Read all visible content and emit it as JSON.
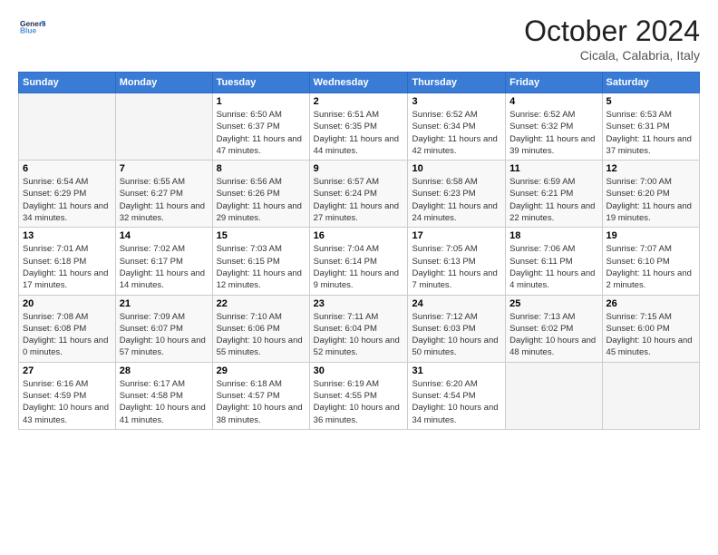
{
  "logo": {
    "line1": "General",
    "line2": "Blue"
  },
  "title": "October 2024",
  "location": "Cicala, Calabria, Italy",
  "days_header": [
    "Sunday",
    "Monday",
    "Tuesday",
    "Wednesday",
    "Thursday",
    "Friday",
    "Saturday"
  ],
  "weeks": [
    [
      {
        "day": "",
        "info": ""
      },
      {
        "day": "",
        "info": ""
      },
      {
        "day": "1",
        "info": "Sunrise: 6:50 AM\nSunset: 6:37 PM\nDaylight: 11 hours and 47 minutes."
      },
      {
        "day": "2",
        "info": "Sunrise: 6:51 AM\nSunset: 6:35 PM\nDaylight: 11 hours and 44 minutes."
      },
      {
        "day": "3",
        "info": "Sunrise: 6:52 AM\nSunset: 6:34 PM\nDaylight: 11 hours and 42 minutes."
      },
      {
        "day": "4",
        "info": "Sunrise: 6:52 AM\nSunset: 6:32 PM\nDaylight: 11 hours and 39 minutes."
      },
      {
        "day": "5",
        "info": "Sunrise: 6:53 AM\nSunset: 6:31 PM\nDaylight: 11 hours and 37 minutes."
      }
    ],
    [
      {
        "day": "6",
        "info": "Sunrise: 6:54 AM\nSunset: 6:29 PM\nDaylight: 11 hours and 34 minutes."
      },
      {
        "day": "7",
        "info": "Sunrise: 6:55 AM\nSunset: 6:27 PM\nDaylight: 11 hours and 32 minutes."
      },
      {
        "day": "8",
        "info": "Sunrise: 6:56 AM\nSunset: 6:26 PM\nDaylight: 11 hours and 29 minutes."
      },
      {
        "day": "9",
        "info": "Sunrise: 6:57 AM\nSunset: 6:24 PM\nDaylight: 11 hours and 27 minutes."
      },
      {
        "day": "10",
        "info": "Sunrise: 6:58 AM\nSunset: 6:23 PM\nDaylight: 11 hours and 24 minutes."
      },
      {
        "day": "11",
        "info": "Sunrise: 6:59 AM\nSunset: 6:21 PM\nDaylight: 11 hours and 22 minutes."
      },
      {
        "day": "12",
        "info": "Sunrise: 7:00 AM\nSunset: 6:20 PM\nDaylight: 11 hours and 19 minutes."
      }
    ],
    [
      {
        "day": "13",
        "info": "Sunrise: 7:01 AM\nSunset: 6:18 PM\nDaylight: 11 hours and 17 minutes."
      },
      {
        "day": "14",
        "info": "Sunrise: 7:02 AM\nSunset: 6:17 PM\nDaylight: 11 hours and 14 minutes."
      },
      {
        "day": "15",
        "info": "Sunrise: 7:03 AM\nSunset: 6:15 PM\nDaylight: 11 hours and 12 minutes."
      },
      {
        "day": "16",
        "info": "Sunrise: 7:04 AM\nSunset: 6:14 PM\nDaylight: 11 hours and 9 minutes."
      },
      {
        "day": "17",
        "info": "Sunrise: 7:05 AM\nSunset: 6:13 PM\nDaylight: 11 hours and 7 minutes."
      },
      {
        "day": "18",
        "info": "Sunrise: 7:06 AM\nSunset: 6:11 PM\nDaylight: 11 hours and 4 minutes."
      },
      {
        "day": "19",
        "info": "Sunrise: 7:07 AM\nSunset: 6:10 PM\nDaylight: 11 hours and 2 minutes."
      }
    ],
    [
      {
        "day": "20",
        "info": "Sunrise: 7:08 AM\nSunset: 6:08 PM\nDaylight: 11 hours and 0 minutes."
      },
      {
        "day": "21",
        "info": "Sunrise: 7:09 AM\nSunset: 6:07 PM\nDaylight: 10 hours and 57 minutes."
      },
      {
        "day": "22",
        "info": "Sunrise: 7:10 AM\nSunset: 6:06 PM\nDaylight: 10 hours and 55 minutes."
      },
      {
        "day": "23",
        "info": "Sunrise: 7:11 AM\nSunset: 6:04 PM\nDaylight: 10 hours and 52 minutes."
      },
      {
        "day": "24",
        "info": "Sunrise: 7:12 AM\nSunset: 6:03 PM\nDaylight: 10 hours and 50 minutes."
      },
      {
        "day": "25",
        "info": "Sunrise: 7:13 AM\nSunset: 6:02 PM\nDaylight: 10 hours and 48 minutes."
      },
      {
        "day": "26",
        "info": "Sunrise: 7:15 AM\nSunset: 6:00 PM\nDaylight: 10 hours and 45 minutes."
      }
    ],
    [
      {
        "day": "27",
        "info": "Sunrise: 6:16 AM\nSunset: 4:59 PM\nDaylight: 10 hours and 43 minutes."
      },
      {
        "day": "28",
        "info": "Sunrise: 6:17 AM\nSunset: 4:58 PM\nDaylight: 10 hours and 41 minutes."
      },
      {
        "day": "29",
        "info": "Sunrise: 6:18 AM\nSunset: 4:57 PM\nDaylight: 10 hours and 38 minutes."
      },
      {
        "day": "30",
        "info": "Sunrise: 6:19 AM\nSunset: 4:55 PM\nDaylight: 10 hours and 36 minutes."
      },
      {
        "day": "31",
        "info": "Sunrise: 6:20 AM\nSunset: 4:54 PM\nDaylight: 10 hours and 34 minutes."
      },
      {
        "day": "",
        "info": ""
      },
      {
        "day": "",
        "info": ""
      }
    ]
  ]
}
